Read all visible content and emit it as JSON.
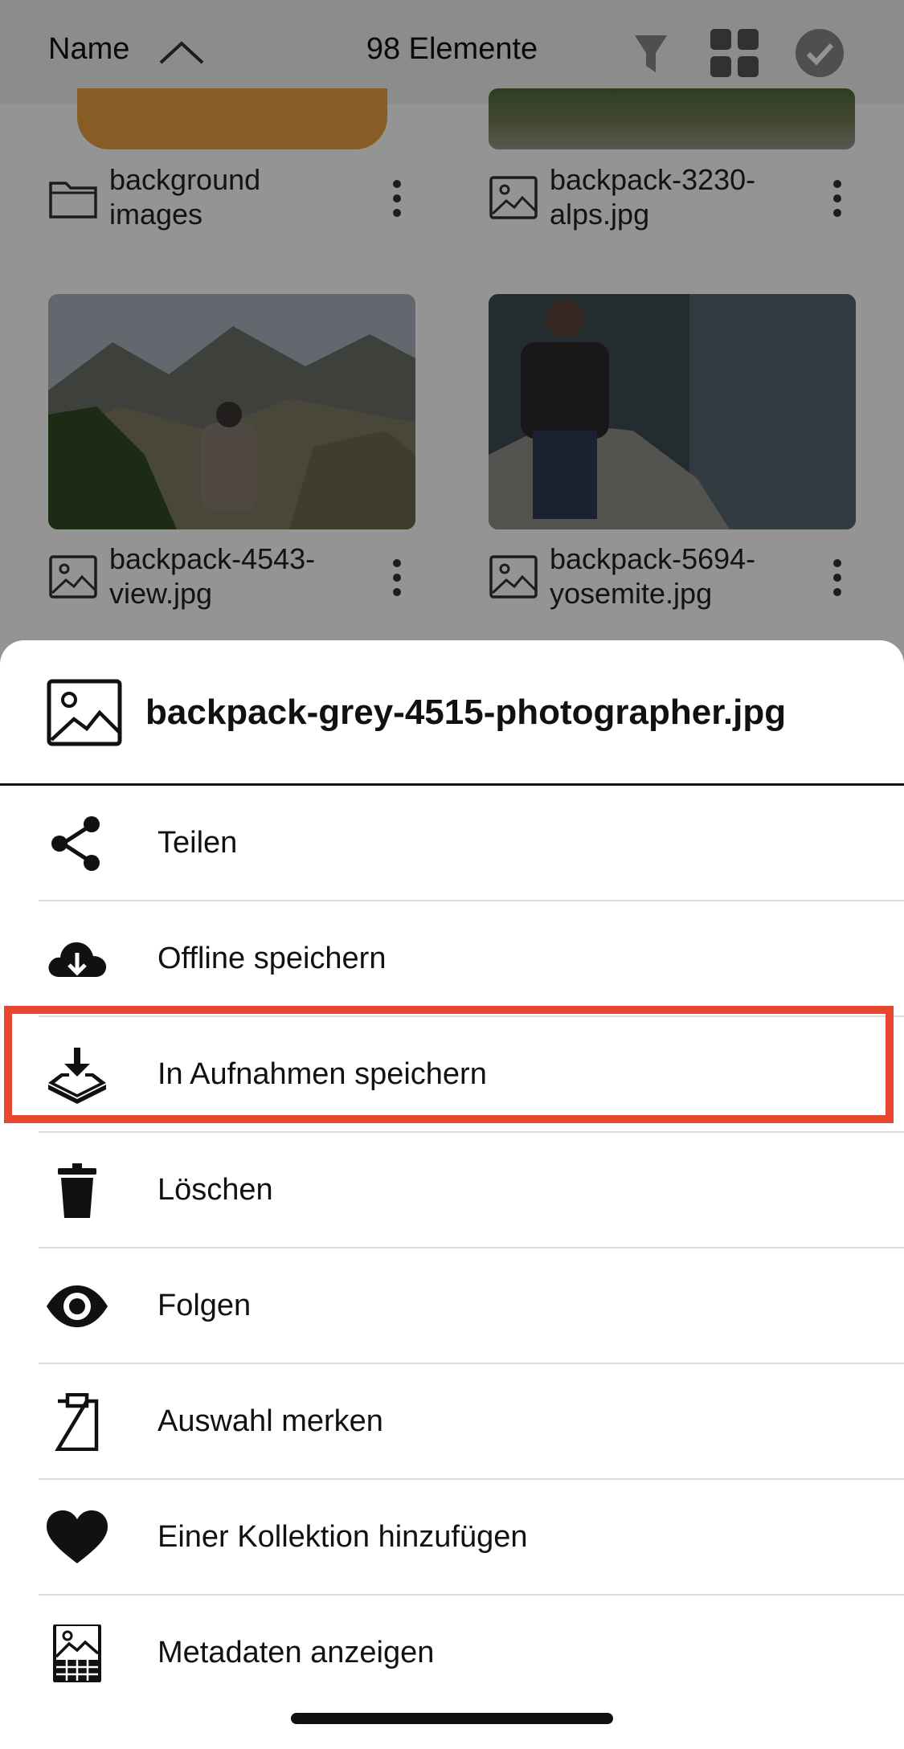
{
  "toolbar": {
    "sort_label": "Name",
    "item_count": "98 Elemente",
    "icons": [
      "chevron-up-icon",
      "filter-icon",
      "grid-view-icon",
      "select-check-icon"
    ]
  },
  "files": [
    {
      "name_line1": "background",
      "name_line2": "images",
      "type": "folder"
    },
    {
      "name_line1": "backpack-3230-",
      "name_line2": "alps.jpg",
      "type": "image"
    },
    {
      "name_line1": "backpack-4543-",
      "name_line2": "view.jpg",
      "type": "image"
    },
    {
      "name_line1": "backpack-5694-",
      "name_line2": "yosemite.jpg",
      "type": "image"
    }
  ],
  "sheet": {
    "title": "backpack-grey-4515-photographer.jpg",
    "items": [
      {
        "label": "Teilen",
        "icon": "share-icon"
      },
      {
        "label": "Offline speichern",
        "icon": "cloud-download-icon"
      },
      {
        "label": "In Aufnahmen speichern",
        "icon": "save-to-photos-icon"
      },
      {
        "label": "Löschen",
        "icon": "trash-icon"
      },
      {
        "label": "Folgen",
        "icon": "eye-icon"
      },
      {
        "label": "Auswahl merken",
        "icon": "clipboard-icon"
      },
      {
        "label": "Einer Kollektion hinzufügen",
        "icon": "heart-icon"
      },
      {
        "label": "Metadaten anzeigen",
        "icon": "metadata-icon"
      }
    ],
    "highlighted_item": "In Aufnahmen speichern"
  },
  "colors": {
    "highlight": "#e8472f",
    "overlay": "rgba(0,0,0,0.42)",
    "folder_thumb": "#e8a040"
  }
}
